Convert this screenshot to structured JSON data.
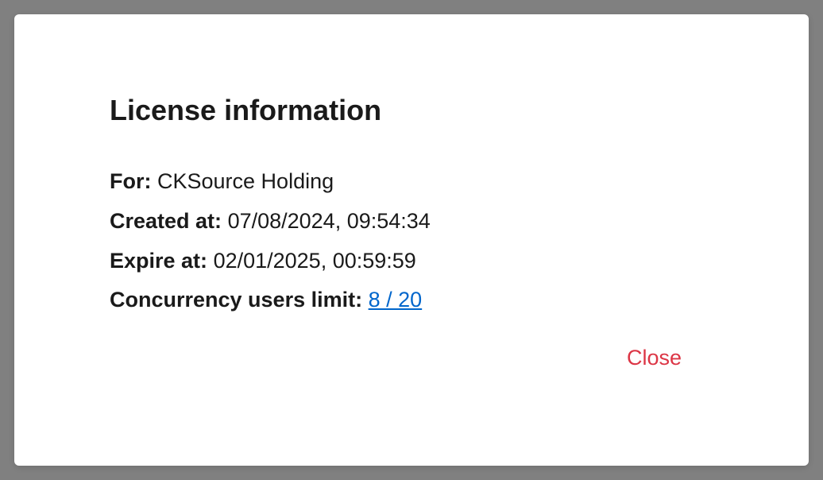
{
  "dialog": {
    "title": "License information",
    "fields": {
      "for_label": "For:",
      "for_value": "CKSource Holding",
      "created_label": "Created at:",
      "created_value": "07/08/2024, 09:54:34",
      "expire_label": "Expire at:",
      "expire_value": "02/01/2025, 00:59:59",
      "concurrency_label": "Concurrency users limit:",
      "concurrency_value": "8 / 20"
    },
    "close_label": "Close"
  }
}
